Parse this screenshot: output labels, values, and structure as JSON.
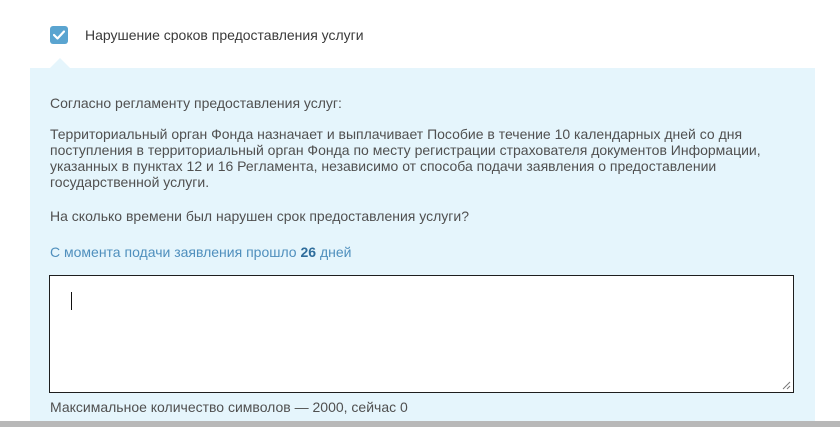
{
  "checkbox": {
    "label": "Нарушение сроков предоставления услуги",
    "checked": true,
    "color": "#5aa4d0"
  },
  "panel": {
    "background": "#e5f5fc",
    "rule_heading": "Согласно регламенту предоставления услуг:",
    "rule_body": "Территориальный орган Фонда назначает и выплачивает Пособие в течение 10 календарных дней со дня поступления в территориальный орган Фонда по месту регистрации страхователя документов Информации, указанных в пунктах 12 и 16 Регламента, независимо от способа подачи заявления о предоставлении государственной услуги.",
    "question": "На сколько времени был нарушен срок предоставления услуги?",
    "elapsed": {
      "prefix": "С момента подачи заявления прошло",
      "days": "26",
      "suffix": "дней"
    }
  },
  "answer": {
    "value": "",
    "counter_text": "Максимальное количество символов — 2000, сейчас 0"
  }
}
